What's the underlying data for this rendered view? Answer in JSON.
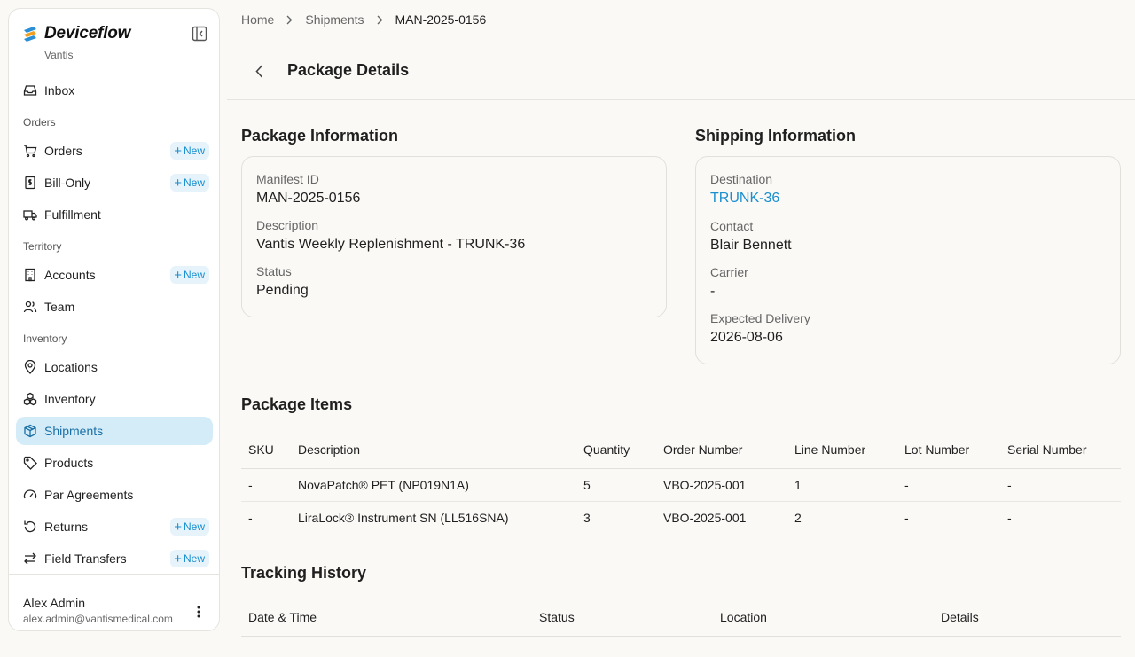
{
  "brand": {
    "name": "Deviceflow",
    "org": "Vantis"
  },
  "sidebar": {
    "inbox": "Inbox",
    "sections": {
      "orders": "Orders",
      "territory": "Territory",
      "inventory": "Inventory"
    },
    "items": {
      "orders": "Orders",
      "bill_only": "Bill-Only",
      "fulfillment": "Fulfillment",
      "accounts": "Accounts",
      "team": "Team",
      "locations": "Locations",
      "inventory": "Inventory",
      "shipments": "Shipments",
      "products": "Products",
      "par_agreements": "Par Agreements",
      "returns": "Returns",
      "field_transfers": "Field Transfers"
    },
    "new_label": "New",
    "active_item": "shipments"
  },
  "user": {
    "name": "Alex Admin",
    "email": "alex.admin@vantismedical.com"
  },
  "breadcrumb": {
    "home": "Home",
    "shipments": "Shipments",
    "current": "MAN-2025-0156"
  },
  "page_title": "Package Details",
  "package_info": {
    "title": "Package Information",
    "manifest_label": "Manifest ID",
    "manifest_value": "MAN-2025-0156",
    "description_label": "Description",
    "description_value": "Vantis Weekly Replenishment - TRUNK-36",
    "status_label": "Status",
    "status_value": "Pending"
  },
  "shipping_info": {
    "title": "Shipping Information",
    "destination_label": "Destination",
    "destination_value": "TRUNK-36",
    "contact_label": "Contact",
    "contact_value": "Blair Bennett",
    "carrier_label": "Carrier",
    "carrier_value": "-",
    "expected_label": "Expected Delivery",
    "expected_value": "2026-08-06"
  },
  "package_items": {
    "title": "Package Items",
    "columns": [
      "SKU",
      "Description",
      "Quantity",
      "Order Number",
      "Line Number",
      "Lot Number",
      "Serial Number"
    ],
    "rows": [
      [
        "-",
        "NovaPatch® PET (NP019N1A)",
        "5",
        "VBO-2025-001",
        "1",
        "-",
        "-"
      ],
      [
        "-",
        "LiraLock® Instrument SN (LL516SNA)",
        "3",
        "VBO-2025-001",
        "2",
        "-",
        "-"
      ]
    ]
  },
  "tracking": {
    "title": "Tracking History",
    "columns": [
      "Date & Time",
      "Status",
      "Location",
      "Details"
    ]
  },
  "colors": {
    "accent": "#1a8fcf",
    "active_bg": "#d4ecf7",
    "background": "#faf9f6"
  }
}
